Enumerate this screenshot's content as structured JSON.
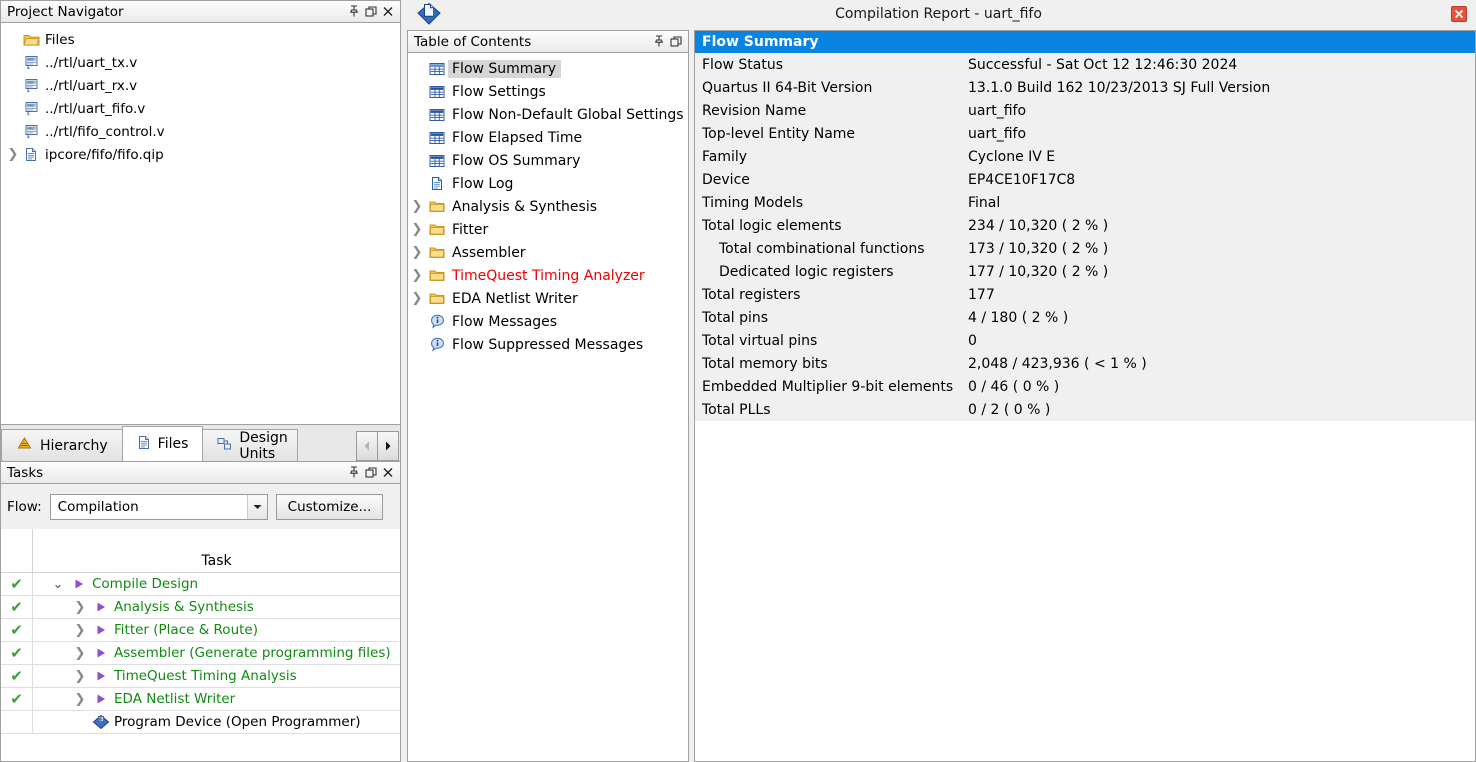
{
  "project_navigator": {
    "title": "Project Navigator",
    "caption_buttons": [
      "pin-icon",
      "restore-icon",
      "close-icon"
    ],
    "root": {
      "label": "Files",
      "icon": "folder-open-icon"
    },
    "files": [
      {
        "label": "../rtl/uart_tx.v",
        "icon": "verilog-file-icon",
        "twisty": ""
      },
      {
        "label": "../rtl/uart_rx.v",
        "icon": "verilog-file-icon",
        "twisty": ""
      },
      {
        "label": "../rtl/uart_fifo.v",
        "icon": "verilog-file-icon",
        "twisty": ""
      },
      {
        "label": "../rtl/fifo_control.v",
        "icon": "verilog-file-icon",
        "twisty": ""
      },
      {
        "label": "ipcore/fifo/fifo.qip",
        "icon": "document-file-icon",
        "twisty": "collapsed"
      }
    ]
  },
  "tabs": [
    {
      "label": "Hierarchy",
      "icon": "hierarchy-icon",
      "active": false
    },
    {
      "label": "Files",
      "icon": "files-icon",
      "active": true
    },
    {
      "label": "Design Units",
      "icon": "design-units-icon",
      "active": false
    }
  ],
  "tab_nav": {
    "prev": "left-arrow-icon",
    "next": "right-arrow-icon"
  },
  "tasks": {
    "title": "Tasks",
    "caption_buttons": [
      "pin-icon",
      "restore-icon",
      "close-icon"
    ],
    "flow_label": "Flow:",
    "flow_value": "Compilation",
    "flow_options": [
      "Compilation"
    ],
    "customize_label": "Customize...",
    "column_header": "Task",
    "rows": [
      {
        "label": "Compile Design",
        "status": "done",
        "twisty": "expanded",
        "icon": "play-icon",
        "indent": 0,
        "green": true
      },
      {
        "label": "Analysis & Synthesis",
        "status": "done",
        "twisty": "collapsed",
        "icon": "play-icon",
        "indent": 1,
        "green": true
      },
      {
        "label": "Fitter (Place & Route)",
        "status": "done",
        "twisty": "collapsed",
        "icon": "play-icon",
        "indent": 1,
        "green": true
      },
      {
        "label": "Assembler (Generate programming files)",
        "status": "done",
        "twisty": "collapsed",
        "icon": "play-icon",
        "indent": 1,
        "green": true
      },
      {
        "label": "TimeQuest Timing Analysis",
        "status": "done",
        "twisty": "collapsed",
        "icon": "play-icon",
        "indent": 1,
        "green": true
      },
      {
        "label": "EDA Netlist Writer",
        "status": "done",
        "twisty": "collapsed",
        "icon": "play-icon",
        "indent": 1,
        "green": true
      },
      {
        "label": "Program Device (Open Programmer)",
        "status": "",
        "twisty": "",
        "icon": "program-device-icon",
        "indent": 1,
        "green": false
      }
    ]
  },
  "window": {
    "title": "Compilation Report - uart_fifo",
    "icon": "compilation-report-icon",
    "close": "close-icon"
  },
  "toc": {
    "title": "Table of Contents",
    "caption_buttons": [
      "pin-icon",
      "restore-icon"
    ],
    "items": [
      {
        "label": "Flow Summary",
        "icon": "report-table-icon",
        "twisty": "",
        "selected": true,
        "red": false
      },
      {
        "label": "Flow Settings",
        "icon": "report-table-icon",
        "twisty": "",
        "selected": false,
        "red": false
      },
      {
        "label": "Flow Non-Default Global Settings",
        "icon": "report-table-icon",
        "twisty": "",
        "selected": false,
        "red": false
      },
      {
        "label": "Flow Elapsed Time",
        "icon": "report-table-icon",
        "twisty": "",
        "selected": false,
        "red": false
      },
      {
        "label": "Flow OS Summary",
        "icon": "report-table-icon",
        "twisty": "",
        "selected": false,
        "red": false
      },
      {
        "label": "Flow Log",
        "icon": "document-file-icon",
        "twisty": "",
        "selected": false,
        "red": false
      },
      {
        "label": "Analysis & Synthesis",
        "icon": "folder-icon",
        "twisty": "collapsed",
        "selected": false,
        "red": false
      },
      {
        "label": "Fitter",
        "icon": "folder-icon",
        "twisty": "collapsed",
        "selected": false,
        "red": false
      },
      {
        "label": "Assembler",
        "icon": "folder-icon",
        "twisty": "collapsed",
        "selected": false,
        "red": false
      },
      {
        "label": "TimeQuest Timing Analyzer",
        "icon": "folder-icon",
        "twisty": "collapsed",
        "selected": false,
        "red": true
      },
      {
        "label": "EDA Netlist Writer",
        "icon": "folder-icon",
        "twisty": "collapsed",
        "selected": false,
        "red": false
      },
      {
        "label": "Flow Messages",
        "icon": "info-icon",
        "twisty": "",
        "selected": false,
        "red": false
      },
      {
        "label": "Flow Suppressed Messages",
        "icon": "info-icon",
        "twisty": "",
        "selected": false,
        "red": false
      }
    ]
  },
  "report": {
    "header": "Flow Summary",
    "rows": [
      {
        "key": "Flow Status",
        "value": "Successful - Sat Oct 12 12:46:30 2024",
        "indent": false
      },
      {
        "key": "Quartus II 64-Bit Version",
        "value": "13.1.0 Build 162 10/23/2013 SJ Full Version",
        "indent": false
      },
      {
        "key": "Revision Name",
        "value": "uart_fifo",
        "indent": false
      },
      {
        "key": "Top-level Entity Name",
        "value": "uart_fifo",
        "indent": false
      },
      {
        "key": "Family",
        "value": "Cyclone IV E",
        "indent": false
      },
      {
        "key": "Device",
        "value": "EP4CE10F17C8",
        "indent": false
      },
      {
        "key": "Timing Models",
        "value": "Final",
        "indent": false
      },
      {
        "key": "Total logic elements",
        "value": "234 / 10,320 ( 2 % )",
        "indent": false
      },
      {
        "key": "Total combinational functions",
        "value": "173 / 10,320 ( 2 % )",
        "indent": true
      },
      {
        "key": "Dedicated logic registers",
        "value": "177 / 10,320 ( 2 % )",
        "indent": true
      },
      {
        "key": "Total registers",
        "value": "177",
        "indent": false
      },
      {
        "key": "Total pins",
        "value": "4 / 180 ( 2 % )",
        "indent": false
      },
      {
        "key": "Total virtual pins",
        "value": "0",
        "indent": false
      },
      {
        "key": "Total memory bits",
        "value": "2,048 / 423,936 ( < 1 % )",
        "indent": false
      },
      {
        "key": "Embedded Multiplier 9-bit elements",
        "value": "0 / 46 ( 0 % )",
        "indent": false
      },
      {
        "key": "Total PLLs",
        "value": "0 / 2 ( 0 % )",
        "indent": false
      }
    ]
  },
  "colors": {
    "report_header_blue": "#0a84e2",
    "selection_gray": "#d6d6d6",
    "task_green": "#128a12",
    "error_red": "#ee0000",
    "close_red": "#e8523a"
  }
}
